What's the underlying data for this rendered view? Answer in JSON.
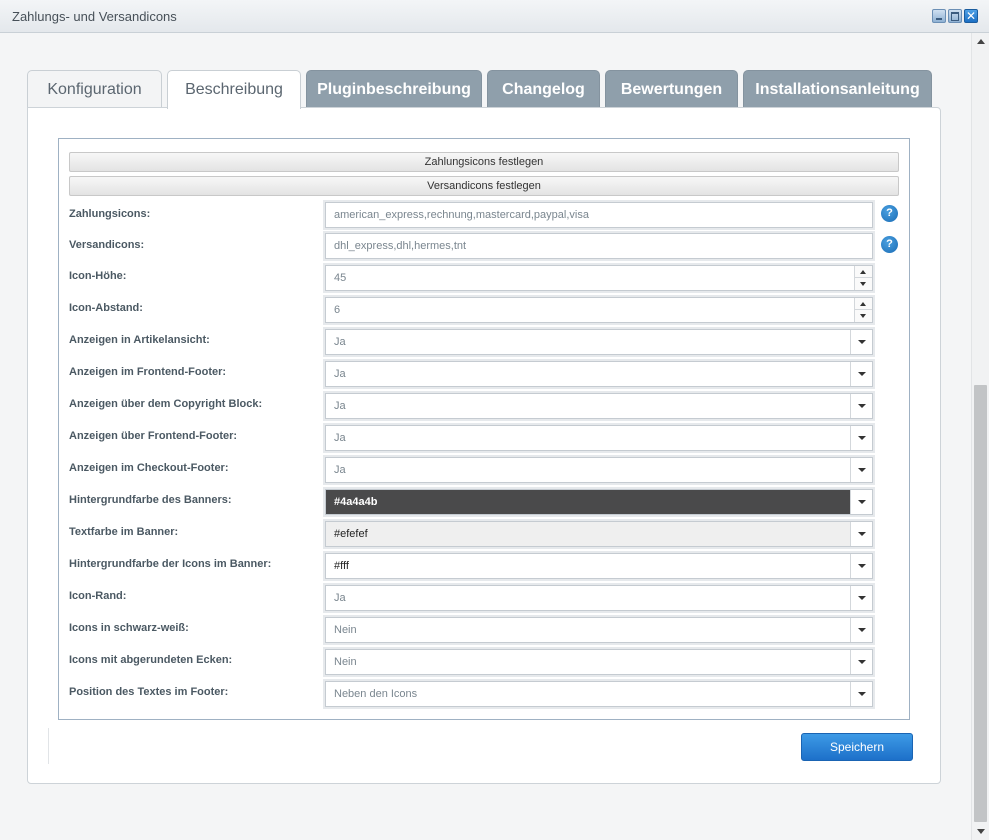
{
  "window": {
    "title": "Zahlungs- und Versandicons"
  },
  "tabs": [
    {
      "label": "Konfiguration"
    },
    {
      "label": "Beschreibung"
    },
    {
      "label": "Pluginbeschreibung"
    },
    {
      "label": "Changelog"
    },
    {
      "label": "Bewertungen"
    },
    {
      "label": "Installationsanleitung"
    }
  ],
  "sections": {
    "payment": "Zahlungsicons festlegen",
    "shipping": "Versandicons festlegen"
  },
  "fields": [
    {
      "label": "Zahlungsicons:",
      "value": "american_express,rechnung,mastercard,paypal,visa"
    },
    {
      "label": "Versandicons:",
      "value": "dhl_express,dhl,hermes,tnt"
    },
    {
      "label": "Icon-Höhe:",
      "value": "45"
    },
    {
      "label": "Icon-Abstand:",
      "value": "6"
    },
    {
      "label": "Anzeigen in Artikelansicht:",
      "value": "Ja"
    },
    {
      "label": "Anzeigen im Frontend-Footer:",
      "value": "Ja"
    },
    {
      "label": "Anzeigen über dem Copyright Block:",
      "value": "Ja"
    },
    {
      "label": "Anzeigen über Frontend-Footer:",
      "value": "Ja"
    },
    {
      "label": "Anzeigen im Checkout-Footer:",
      "value": "Ja"
    },
    {
      "label": "Hintergrundfarbe des Banners:",
      "value": "#4a4a4b"
    },
    {
      "label": "Textfarbe im Banner:",
      "value": "#efefef"
    },
    {
      "label": "Hintergrundfarbe der Icons im Banner:",
      "value": "#fff"
    },
    {
      "label": "Icon-Rand:",
      "value": "Ja"
    },
    {
      "label": "Icons in schwarz-weiß:",
      "value": "Nein"
    },
    {
      "label": "Icons mit abgerundeten Ecken:",
      "value": "Nein"
    },
    {
      "label": "Position des Textes im Footer:",
      "value": "Neben den Icons"
    }
  ],
  "help_glyph": "?",
  "buttons": {
    "save": "Speichern"
  },
  "colors": {
    "accent": "#1d70c9",
    "tab_dark": "#8f9fab",
    "banner_bg": "#4a4a4b",
    "banner_text": "#efefef"
  },
  "icons": {
    "help": "help-icon",
    "minimize": "minimize-icon",
    "maximize": "maximize-icon",
    "close": "close-icon"
  }
}
